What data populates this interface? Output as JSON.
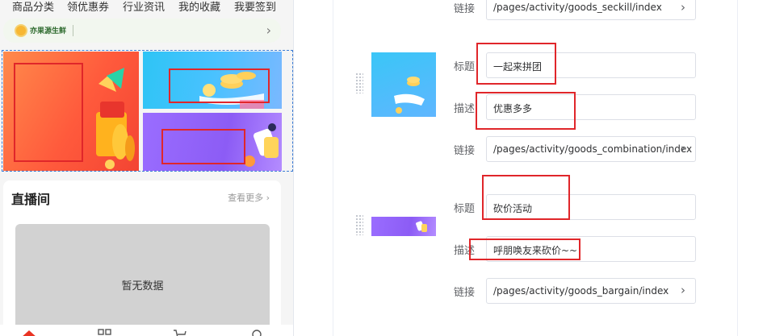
{
  "phone": {
    "nav": [
      "商品分类",
      "领优惠券",
      "行业资讯",
      "我的收藏",
      "我要签到"
    ],
    "brand": {
      "name": "亦果源生鲜"
    },
    "live": {
      "title": "直播间",
      "more": "查看更多",
      "empty": "暂无数据"
    }
  },
  "editor": {
    "top_link": {
      "label": "链接",
      "value": "/pages/activity/goods_seckill/index"
    },
    "items": [
      {
        "title_label": "标题",
        "title_value": "一起来拼团",
        "desc_label": "描述",
        "desc_value": "优惠多多",
        "link_label": "链接",
        "link_value": "/pages/activity/goods_combination/index"
      },
      {
        "title_label": "标题",
        "title_value": "砍价活动",
        "desc_label": "描述",
        "desc_value": "呼朋唤友来砍价~~",
        "link_label": "链接",
        "link_value": "/pages/activity/goods_bargain/index"
      }
    ]
  },
  "colors": {
    "highlight": "#e0262a",
    "accent": "#3a7bd5"
  }
}
